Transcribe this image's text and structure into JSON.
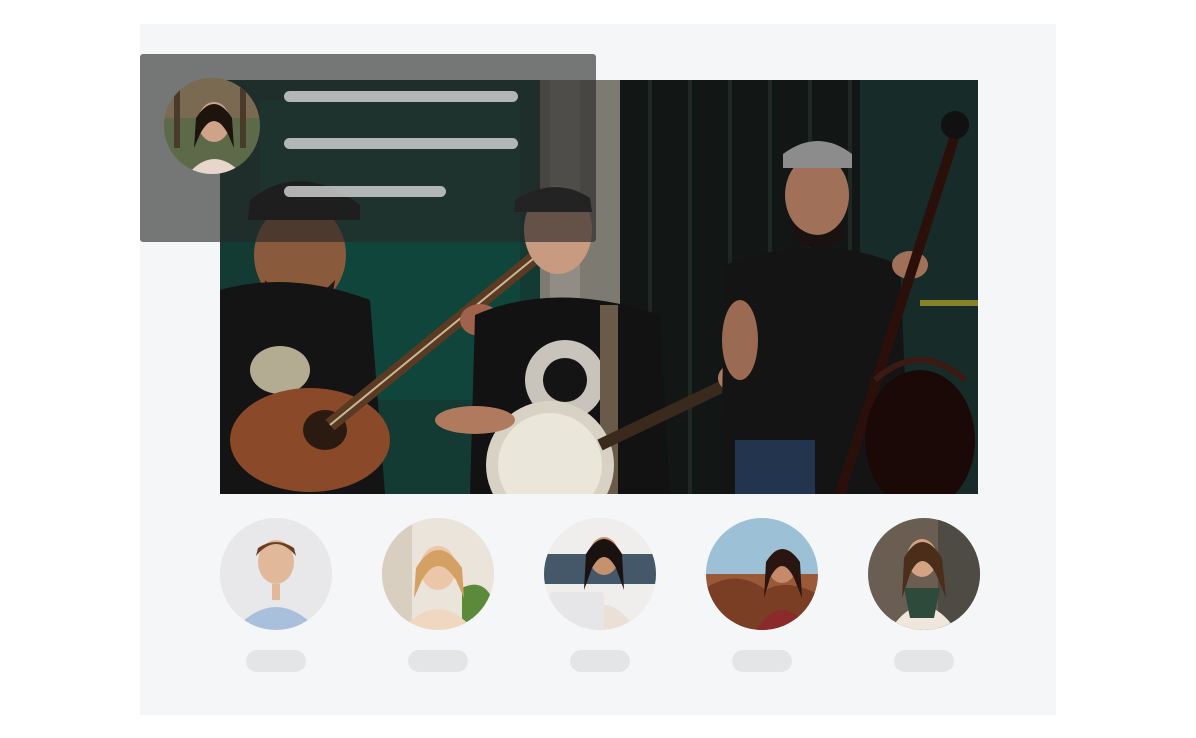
{
  "hero": {
    "image": "street-band-photo",
    "overlay": {
      "avatar_icon": "profile-photo-woman",
      "text_lines": 3
    }
  },
  "profiles": [
    {
      "avatar": "man-blue-shirt-photo"
    },
    {
      "avatar": "woman-blonde-photo"
    },
    {
      "avatar": "woman-laptop-photo"
    },
    {
      "avatar": "woman-canyon-photo"
    },
    {
      "avatar": "woman-scarf-photo"
    }
  ],
  "colors": {
    "panel_bg": "#f5f6f8",
    "overlay_bg": "rgba(38,38,38,0.62)",
    "skeleton_line": "#dcdcdc",
    "name_pill": "#e4e5e7"
  }
}
